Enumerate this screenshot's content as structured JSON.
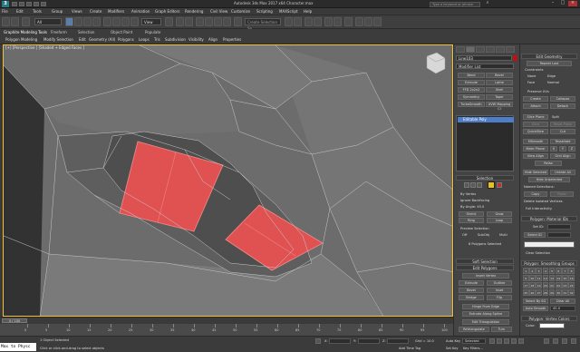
{
  "titlebar": {
    "title": "Autodesk 3ds Max 2017 x64    Character.max",
    "search_placeholder": "Type a keyword or phrase",
    "logo": "3"
  },
  "menubar": {
    "items": [
      "File",
      "Edit",
      "Tools",
      "Group",
      "Views",
      "Create",
      "Modifiers",
      "Animation",
      "Graph Editors",
      "Rendering",
      "Civil View",
      "Customize",
      "Scripting",
      "MAXScript",
      "Help"
    ]
  },
  "toolbar": {
    "filter_value": "All",
    "refcoord_value": "View",
    "selset_placeholder": "Create Selection Se"
  },
  "ribbon": {
    "tabs": [
      "Graphite Modeling Tools",
      "Freeform",
      "Selection",
      "Object Paint",
      "Populate"
    ],
    "subtabs": [
      "Polygon Modeling",
      "Modify Selection",
      "Edit",
      "Geometry (All)",
      "Polygons",
      "Loops",
      "Tris",
      "Subdivision",
      "Visibility",
      "Align",
      "Properties"
    ]
  },
  "viewport": {
    "label": "[+] [Perspective ] [Shaded + Edged Faces ]",
    "selection_color": "#e05252",
    "border_color": "#f2c230"
  },
  "command_panel": {
    "object_name": "Line103",
    "object_color": "#c01010",
    "modifier_list": "Modifier List",
    "buttons": [
      [
        "Bend",
        "Bevel"
      ],
      [
        "Extrude",
        "Lathe"
      ],
      [
        "FFD 2x2x2",
        "Shell"
      ],
      [
        "Symmetry",
        "Taper"
      ],
      [
        "TurboSmooth",
        "UVW Mapping Cl"
      ]
    ],
    "stack_item": "Editable Poly",
    "selection_header": "Selection",
    "sel_options": [
      "By Vertex",
      "Ignore Backfacing",
      "By Angle: 45.0"
    ],
    "shrink": "Shrink",
    "grow": "Grow",
    "ring": "Ring",
    "loop": "Loop",
    "preview_sel": "Preview Selection",
    "preview_opts": [
      "Off",
      "SubObj",
      "Multi"
    ],
    "sel_status": "8 Polygons Selected",
    "soft_sel": "Soft Selection",
    "edit_polys": "Edit Polygons",
    "insert_vertex": "Insert Vertex",
    "ep_buttons": [
      [
        "Extrude",
        "Outline"
      ],
      [
        "Bevel",
        "Inset"
      ],
      [
        "Bridge",
        "Flip"
      ]
    ],
    "hinge": "Hinge From Edge",
    "extrude_spline": "Extrude Along Spline",
    "edit_tri": "Edit Triangulation",
    "retri": [
      "Retriangulate",
      "Turn"
    ]
  },
  "right_panel": {
    "header": "Edit Geometry",
    "repeat_last": "Repeat Last",
    "constraints": "Constraints",
    "constraint_opts": [
      "None",
      "Edge",
      "Face",
      "Normal"
    ],
    "preserve_uvs": "Preserve UVs",
    "create": "Create",
    "collapse": "Collapse",
    "attach": "Attach",
    "detach": "Detach",
    "slice_plane": "Slice Plane",
    "split": "Split",
    "slice": "Slice",
    "reset_plane": "Reset Plane",
    "quickslice": "QuickSlice",
    "cut": "Cut",
    "msmooth": "MSmooth",
    "tessellate": "Tessellate",
    "make_planar": "Make Planar",
    "xyz": [
      "X",
      "Y",
      "Z"
    ],
    "view_align": "View Align",
    "grid_align": "Grid Align",
    "relax": "Relax",
    "hide_selected": "Hide Selected",
    "unhide_all": "Unhide All",
    "hide_unselected": "Hide Unselected",
    "named_sel": "Named Selections:",
    "copy": "Copy",
    "paste": "Paste",
    "delete_isolated": "Delete Isolated Vertices",
    "full_interactivity": "Full Interactivity",
    "mat_ids": "Polygon: Material IDs",
    "set_id": "Set ID:",
    "select_id": "Select ID",
    "clear_selection": "Clear Selection",
    "smoothing": "Polygon: Smoothing Groups",
    "sg_numbers": [
      "1",
      "2",
      "3",
      "4",
      "5",
      "6",
      "7",
      "8",
      "9",
      "10",
      "11",
      "12",
      "13",
      "14",
      "15",
      "16",
      "17",
      "18",
      "19",
      "20",
      "21",
      "22",
      "23",
      "24",
      "25",
      "26",
      "27",
      "28",
      "29",
      "30",
      "31",
      "32"
    ],
    "select_by_sg": "Select By SG",
    "clear_all": "Clear All",
    "auto_smooth": "Auto Smooth",
    "auto_smooth_value": "45.0",
    "vertex_colors": "Polygon: Vertex Colors",
    "color_label": "Color:"
  },
  "timeline": {
    "frame": "0 / 100",
    "ticks": [
      "0",
      "5",
      "10",
      "15",
      "20",
      "25",
      "30",
      "35",
      "40",
      "45",
      "50",
      "55",
      "60",
      "65",
      "70",
      "75",
      "80",
      "85",
      "90",
      "95",
      "100"
    ]
  },
  "statusbar": {
    "maxscript": "Max to Physc",
    "status": "1 Object Selected",
    "prompt": "Click or click-and-drag to select objects",
    "x": "X:",
    "y": "Y:",
    "z": "Z:",
    "grid": "Grid = 10.0",
    "add_time_tag": "Add Time Tag",
    "auto_key": "Auto Key",
    "set_key": "Set Key",
    "selected": "Selected",
    "key_filters": "Key Filters..."
  }
}
